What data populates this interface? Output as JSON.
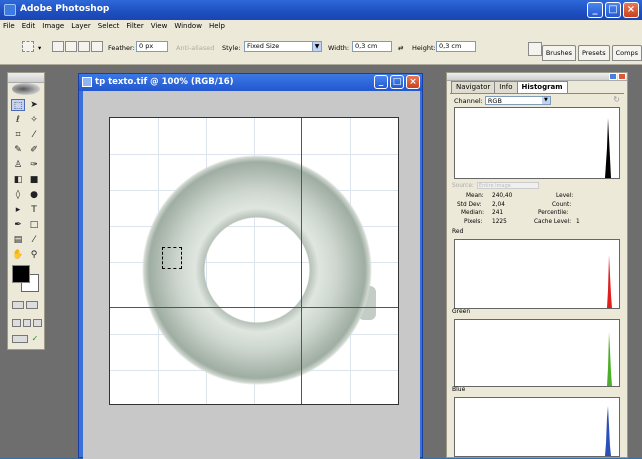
{
  "app": {
    "title": "Adobe Photoshop"
  },
  "menu": [
    "File",
    "Edit",
    "Image",
    "Layer",
    "Select",
    "Filter",
    "View",
    "Window",
    "Help"
  ],
  "options": {
    "feather_label": "Feather:",
    "feather_value": "0 px",
    "antialiased_label": "Anti-aliased",
    "style_label": "Style:",
    "style_value": "Fixed Size",
    "width_label": "Width:",
    "width_value": "0,3 cm",
    "height_label": "Height:",
    "height_value": "0,3 cm"
  },
  "palette_well": [
    "Brushes",
    "Presets",
    "Comps"
  ],
  "document": {
    "title": "tp texto.tif @ 100% (RGB/16)"
  },
  "histogram_panel": {
    "tabs": [
      "Navigator",
      "Info",
      "Histogram"
    ],
    "active_tab": "Histogram",
    "channel_label": "Channel:",
    "channel_value": "RGB",
    "source_label": "Source:",
    "source_value": "Entire Image",
    "stats": {
      "mean_label": "Mean:",
      "mean": "240,40",
      "stddev_label": "Std Dev:",
      "stddev": "2,04",
      "median_label": "Median:",
      "median": "241",
      "pixels_label": "Pixels:",
      "pixels": "1225",
      "level_label": "Level:",
      "count_label": "Count:",
      "percentile_label": "Percentile:",
      "cache_label": "Cache Level:",
      "cache": "1"
    },
    "channels": [
      {
        "name": "Red",
        "color": "#e01e1e"
      },
      {
        "name": "Green",
        "color": "#4caf2a"
      },
      {
        "name": "Blue",
        "color": "#2a4fb8"
      }
    ]
  }
}
